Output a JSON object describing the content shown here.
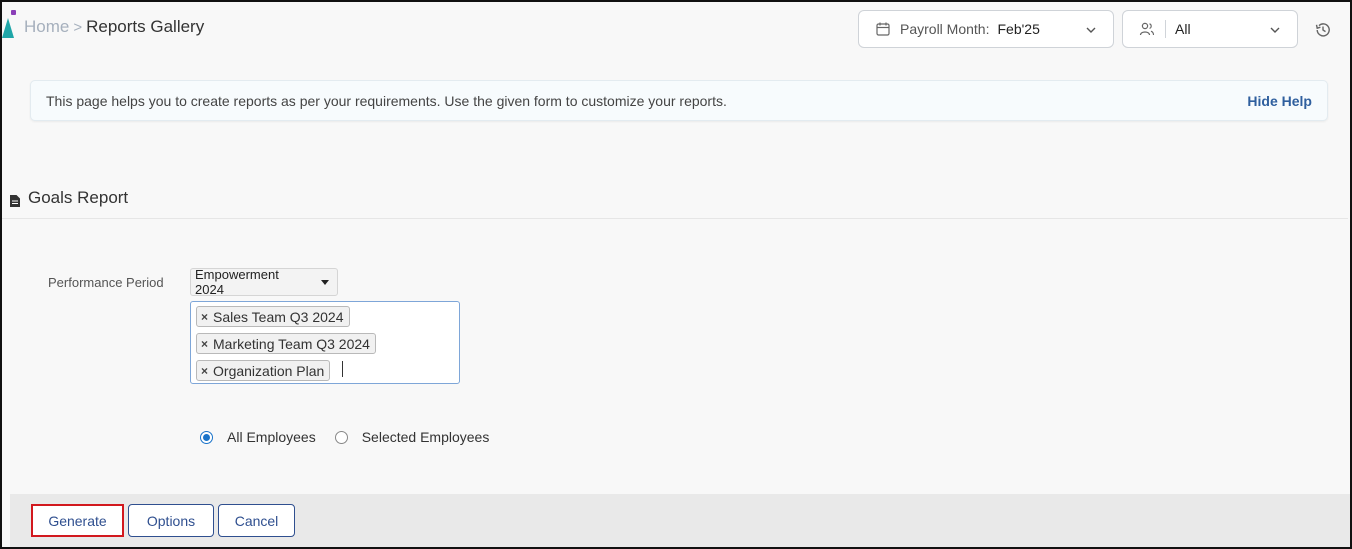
{
  "breadcrumb": {
    "home": "Home",
    "separator": ">",
    "current": "Reports Gallery"
  },
  "payroll": {
    "label": "Payroll Month:",
    "value": "Feb'25",
    "icon": "calendar-icon"
  },
  "scope": {
    "value": "All",
    "icon": "users-icon"
  },
  "help": {
    "message": "This page helps you to create reports as per your requirements. Use the given form to customize your reports.",
    "hide_label": "Hide Help"
  },
  "section": {
    "title": "Goals Report"
  },
  "form": {
    "performance_period_label": "Performance Period",
    "performance_period_value": "Empowerment 2024",
    "selected_periods": [
      "Sales Team Q3 2024",
      "Marketing Team Q3 2024",
      "Organization Plan"
    ],
    "tag_remove": "×",
    "radio_all": "All Employees",
    "radio_selected": "Selected Employees",
    "radio_checked": "All Employees"
  },
  "footer": {
    "generate": "Generate",
    "options": "Options",
    "cancel": "Cancel"
  },
  "colors": {
    "accent": "#2f4f8f",
    "highlight": "#d2181e",
    "radio": "#1a73c9"
  }
}
